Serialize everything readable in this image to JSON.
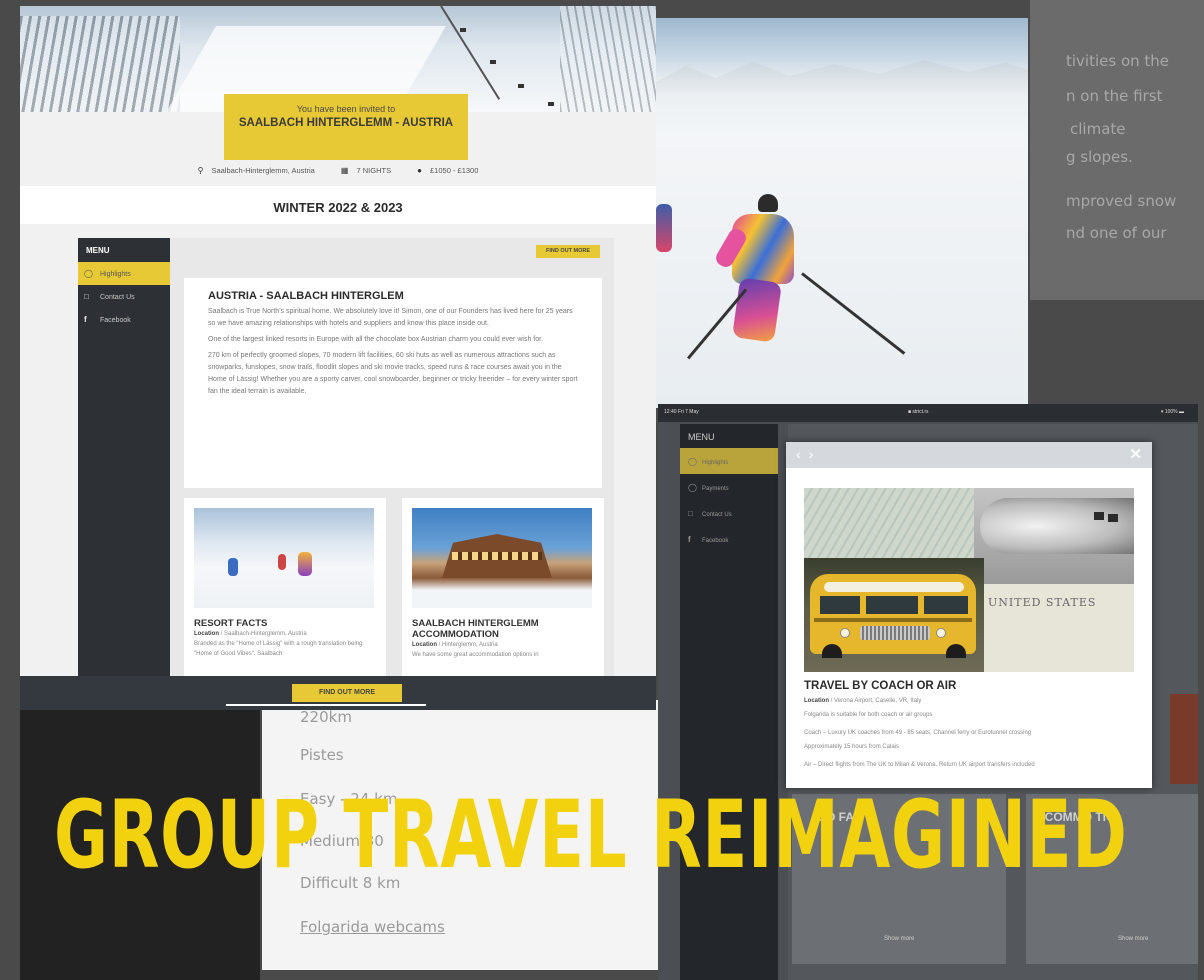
{
  "background": {
    "right_text_lines": [
      "tivities on the",
      "n on the first",
      "climate",
      "g slopes.",
      "mproved snow",
      "nd one of our"
    ],
    "left_blur_lines": [
      "220km",
      "Pistes",
      "Easy - 24 km",
      "Medium 30",
      "Difficult 8 km",
      "Folgarida webcams"
    ]
  },
  "website": {
    "invite_small": "You have been invited to",
    "invite_title": "SAALBACH HINTERGLEMM - AUSTRIA",
    "location": "Saalbach-Hinterglemm, Austria",
    "nights": "7 NIGHTS",
    "price": "£1050 - £1300",
    "season": "WINTER 2022 & 2023",
    "menu_title": "MENU",
    "menu_items": [
      {
        "label": "Highlights",
        "icon": "circle-icon"
      },
      {
        "label": "Contact Us",
        "icon": "chat-icon"
      },
      {
        "label": "Facebook",
        "icon": "facebook-icon"
      }
    ],
    "find_out_more": "FIND OUT MORE",
    "article": {
      "title": "AUSTRIA - SAALBACH HINTERGLEM",
      "paragraphs": [
        "Saalbach is True North's spiritual home. We absolutely love it! Simon, one of our Founders has lived here for 25 years so we have amazing relationships with hotels and suppliers and know this place inside out.",
        "One of the largest linked resorts in Europe with all the chocolate box Austrian charm you could ever wish for.",
        "270 km of perfectly groomed slopes, 70 modern lift facilities, 60 ski huts as well as numerous attractions such as snowparks, funslopes, snow trails, floodlit slopes and ski movie tracks, speed runs & race courses await you in the Home of Lässig! Whether you are a sporty carver, cool snowboarder, beginner or tricky freerider – for every winter sport fan the ideal terrain is available."
      ]
    },
    "cards": [
      {
        "title": "RESORT FACTS",
        "location_label": "Location",
        "location": "Saalbach-Hinterglemm, Austria",
        "text": "Branded as the \"Home of Lässig\" with a rough translation being \"Home of Good Vibes\". Saalbach"
      },
      {
        "title": "SAALBACH HINTERGLEMM ACCOMMODATION",
        "location_label": "Location",
        "location": "Hinterglemm, Austria",
        "text": "We have some great accommodation options in"
      }
    ],
    "bottom_button": "FIND OUT MORE"
  },
  "tablet": {
    "status_time": "12:40  Fri 7 May",
    "status_url": "■ strict.rs",
    "status_battery": "▾ 100% ▬",
    "menu_title": "MENU",
    "menu_items": [
      {
        "label": "Highlights",
        "icon": "circle-icon"
      },
      {
        "label": "Payments",
        "icon": "pound-icon"
      },
      {
        "label": "Contact Us",
        "icon": "chat-icon"
      },
      {
        "label": "Facebook",
        "icon": "facebook-icon"
      }
    ],
    "bg_labels": [
      "SO  FAC",
      "CCOMMO  TIO"
    ],
    "show_more": "Show more",
    "modal": {
      "prev_icon": "‹",
      "next_icon": "›",
      "close_icon": "✕",
      "stamp_text": "UNITED STATES",
      "title": "TRAVEL BY COACH OR AIR",
      "location_label": "Location",
      "location": "Verona Airport, Caselle, VR, Italy",
      "lines": [
        "Folgarida is suitable for both coach or air groups",
        "Coach – Luxury UK coaches from 49 - 85 seats, Channel ferry or Eurotunnel crossing",
        "Approximately 15 hours from Calais",
        "Air – Direct flights from The UK to Milan & Verona. Return UK airport transfers included"
      ]
    }
  },
  "headline": "GROUP TRAVEL REIMAGINED",
  "colors": {
    "accent": "#e7c936",
    "headline": "#f2d20f",
    "sidebar": "#2d3136"
  }
}
